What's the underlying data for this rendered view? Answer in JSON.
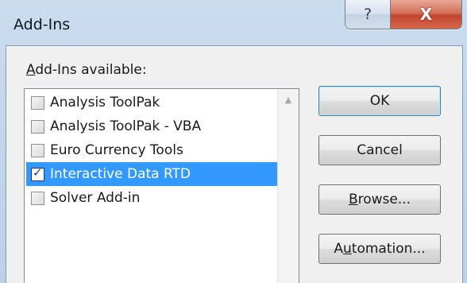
{
  "window": {
    "title": "Add-Ins",
    "help_glyph": "?",
    "close_glyph": "X"
  },
  "list": {
    "label_mnemonic": "A",
    "label_rest": "dd-Ins available:",
    "items": [
      {
        "label": "Analysis ToolPak",
        "checked": false,
        "selected": false
      },
      {
        "label": "Analysis ToolPak - VBA",
        "checked": false,
        "selected": false
      },
      {
        "label": "Euro Currency Tools",
        "checked": false,
        "selected": false
      },
      {
        "label": "Interactive Data RTD",
        "checked": true,
        "selected": true
      },
      {
        "label": "Solver Add-in",
        "checked": false,
        "selected": false
      }
    ],
    "scroll_up_glyph": "▲"
  },
  "buttons": {
    "ok": "OK",
    "cancel": "Cancel",
    "browse_mnemonic": "B",
    "browse_rest": "rowse...",
    "automation_pre": "A",
    "automation_mnemonic": "u",
    "automation_rest": "tomation..."
  },
  "colors": {
    "selection": "#3399ff",
    "close_button": "#c2452c",
    "dialog_face": "#f0f0f0"
  }
}
